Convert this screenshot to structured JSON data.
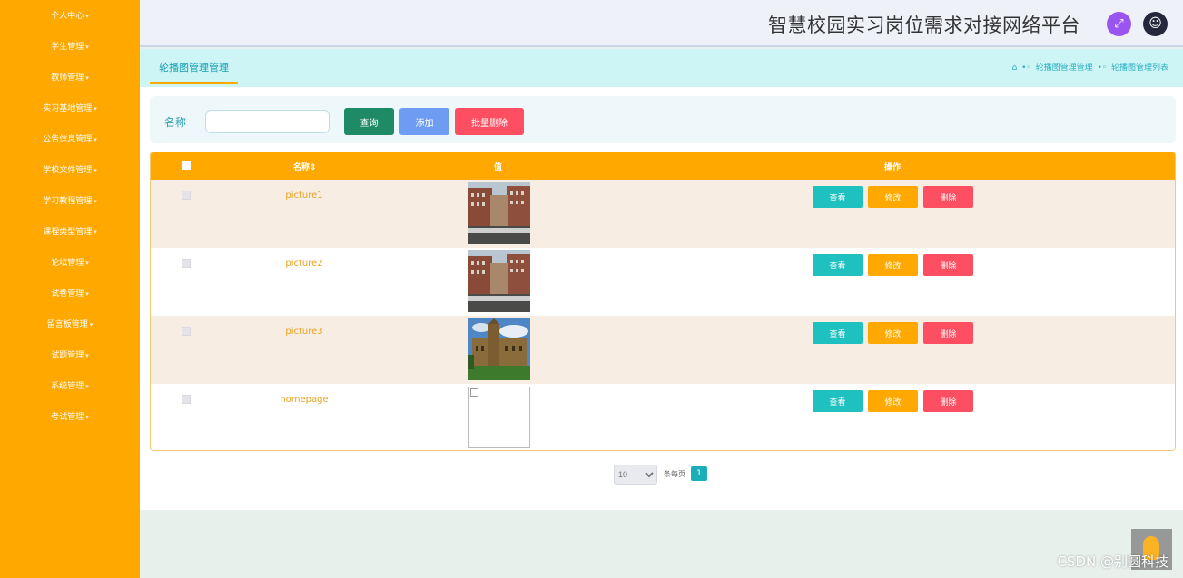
{
  "app": {
    "title": "智慧校园实习岗位需求对接网络平台"
  },
  "sidebar": {
    "items": [
      {
        "label": "个人中心"
      },
      {
        "label": "学生管理"
      },
      {
        "label": "教师管理"
      },
      {
        "label": "实习基地管理"
      },
      {
        "label": "公告信息管理"
      },
      {
        "label": "学校文件管理"
      },
      {
        "label": "学习教程管理"
      },
      {
        "label": "课程类型管理"
      },
      {
        "label": "论坛管理"
      },
      {
        "label": "试卷管理"
      },
      {
        "label": "留言板管理"
      },
      {
        "label": "试题管理"
      },
      {
        "label": "系统管理"
      },
      {
        "label": "考试管理"
      }
    ],
    "caret": "▾"
  },
  "header": {
    "fullscreen_icon": "⤢",
    "user_icon": "☺"
  },
  "breadcrumb": {
    "tab": "轮播图管理管理",
    "home_icon": "⌂",
    "sep": "•◦",
    "items": [
      "轮播图管理管理",
      "轮播图管理列表"
    ]
  },
  "search": {
    "label": "名称",
    "value": "",
    "placeholder": "",
    "query_label": "查询",
    "add_label": "添加",
    "batch_delete_label": "批量删除"
  },
  "table": {
    "headers": {
      "name": "名称⇕",
      "value": "值",
      "actions": "操作"
    },
    "rows": [
      {
        "name": "picture1",
        "image": "campus-building"
      },
      {
        "name": "picture2",
        "image": "campus-building"
      },
      {
        "name": "picture3",
        "image": "college-tower"
      },
      {
        "name": "homepage",
        "image": "broken"
      }
    ],
    "buttons": {
      "view": "查看",
      "edit": "修改",
      "delete": "删除"
    }
  },
  "pagination": {
    "page_size": "10",
    "per_page_label": "条每页",
    "current_page": "1"
  },
  "watermark": "CSDN @别圆科技",
  "colors": {
    "sidebar": "#ffa800",
    "accent": "#1aaeb8",
    "delete": "#fe4e62"
  }
}
